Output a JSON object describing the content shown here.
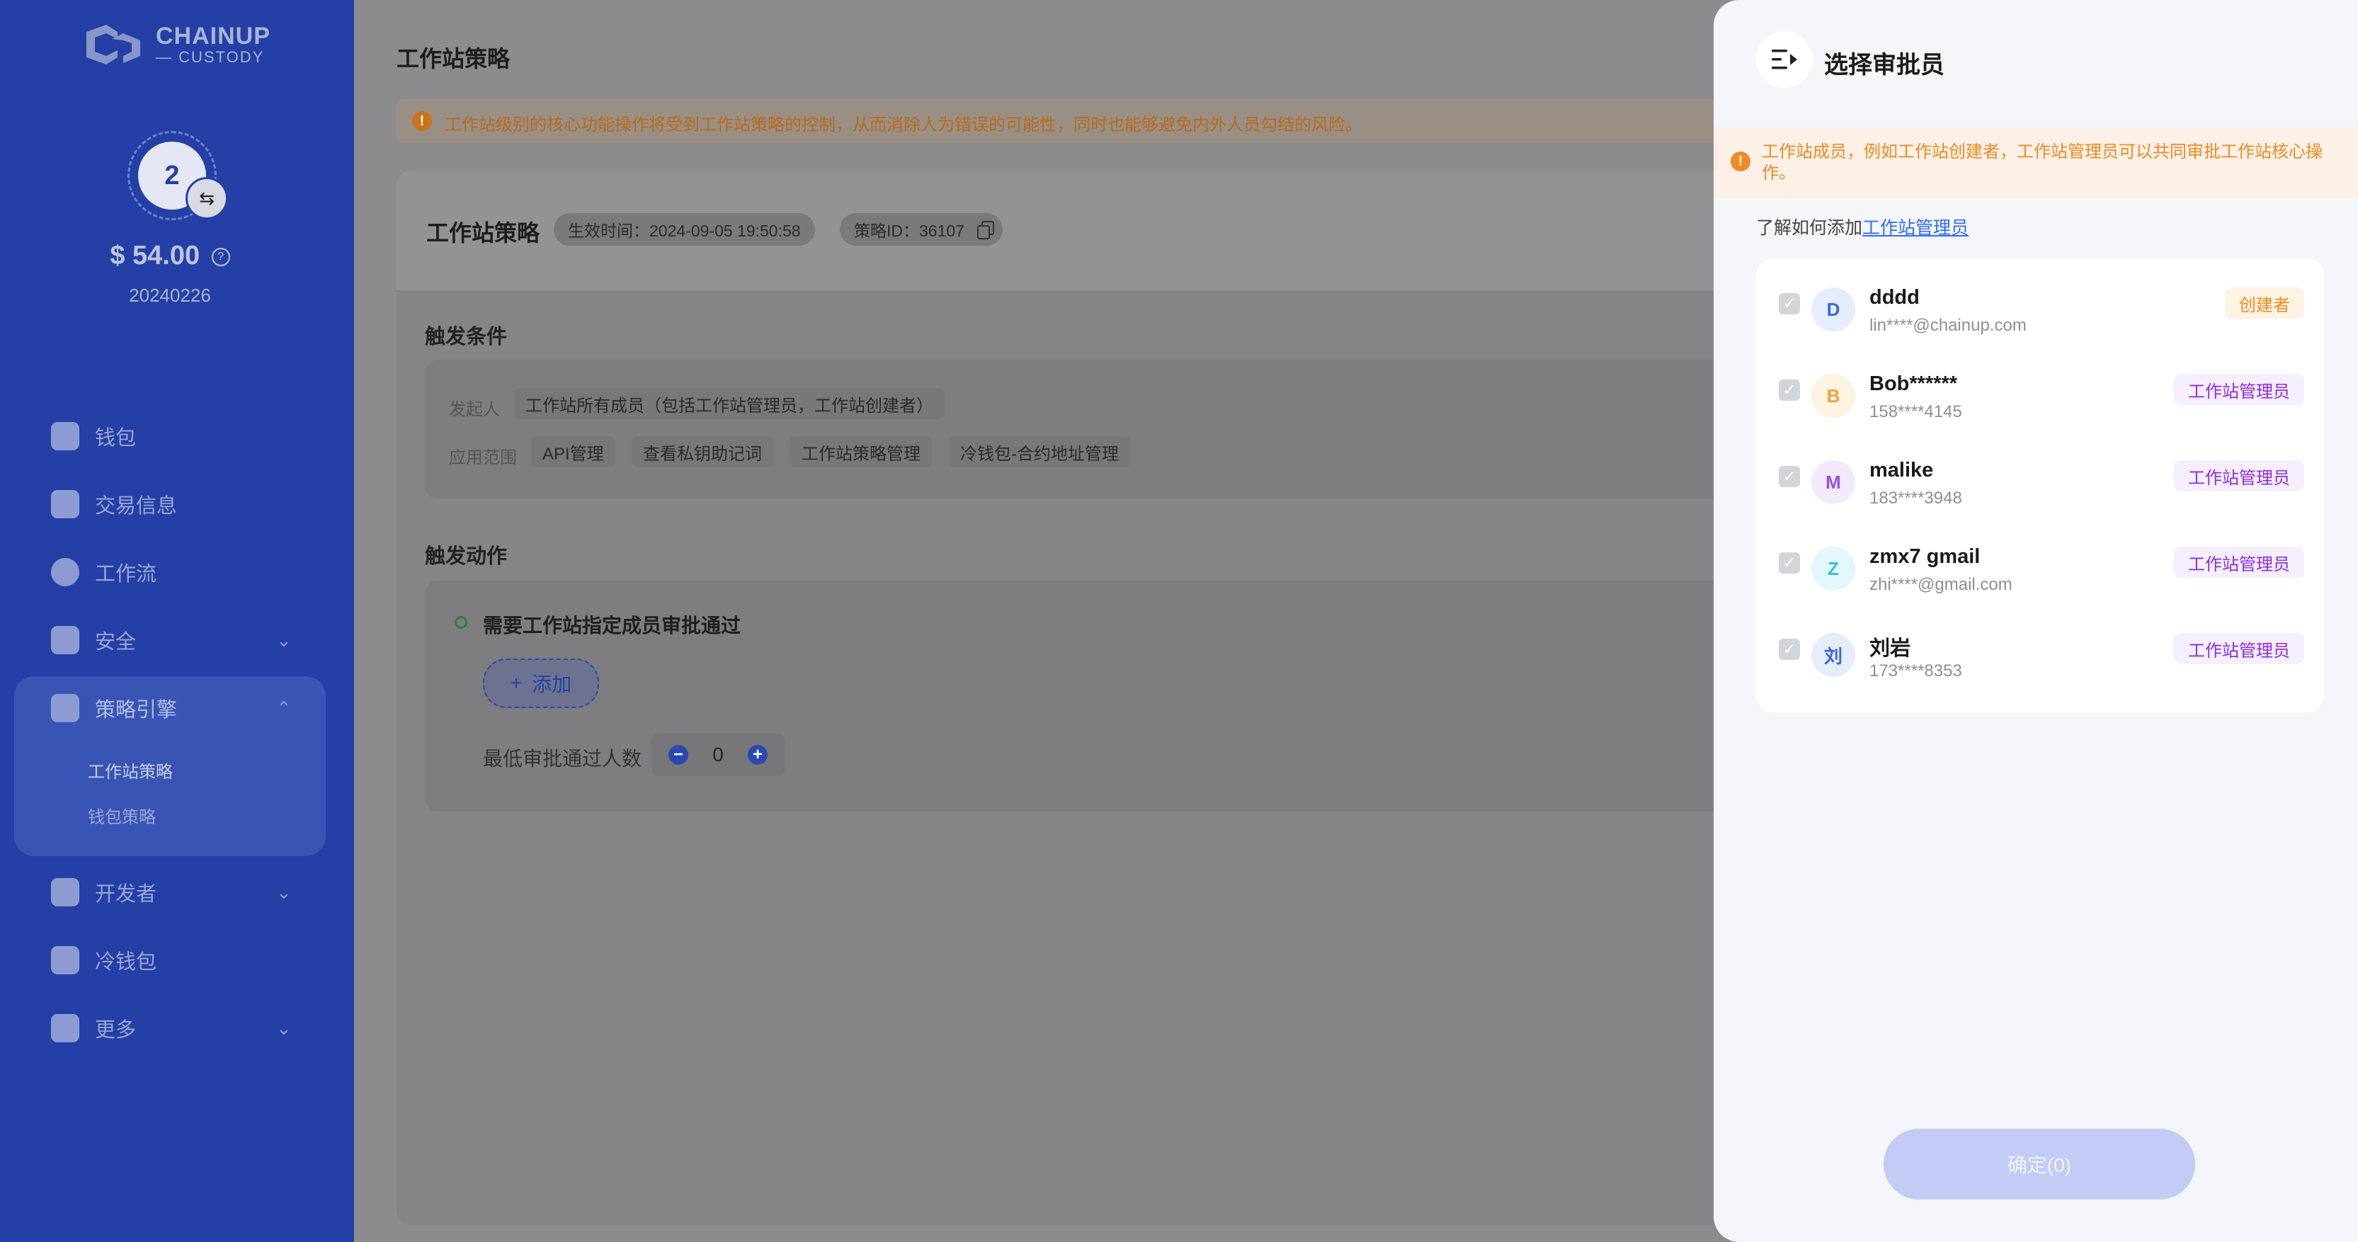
{
  "sidebar": {
    "logo": {
      "line1": "CHAINUP",
      "line2": "— CUSTODY"
    },
    "workspace": {
      "avatar_text": "2",
      "switch_icon": "⇆",
      "balance": "$ 54.00",
      "help_icon": "?",
      "name": "20240226"
    },
    "nav": [
      {
        "label": "钱包",
        "icon": "wallet-icon"
      },
      {
        "label": "交易信息",
        "icon": "transactions-icon"
      },
      {
        "label": "工作流",
        "icon": "workflow-icon"
      },
      {
        "label": "安全",
        "icon": "shield-icon",
        "chevron": "⌄"
      },
      {
        "label": "策略引擎",
        "icon": "policy-engine-icon",
        "chevron": "⌃"
      },
      {
        "label": "开发者",
        "icon": "developer-icon",
        "chevron": "⌄"
      },
      {
        "label": "冷钱包",
        "icon": "cold-wallet-icon"
      },
      {
        "label": "更多",
        "icon": "more-icon",
        "chevron": "⌄"
      }
    ],
    "sub_items": [
      "工作站策略",
      "钱包策略"
    ]
  },
  "main": {
    "page_title": "工作站策略",
    "warning": "工作站级别的核心功能操作将受到工作站策略的控制，从而消除人为错误的可能性，同时也能够避免内外人员勾结的风险。",
    "policy": {
      "title": "工作站策略",
      "effective": "生效时间：2024-09-05 19:50:58",
      "policy_id": "策略ID：36107"
    },
    "conditions": {
      "title": "触发条件",
      "initiator_label": "发起人",
      "initiator_value": "工作站所有成员（包括工作站管理员，工作站创建者）",
      "scope_label": "应用范围",
      "scope_tags": [
        "API管理",
        "查看私钥助记词",
        "工作站策略管理",
        "冷钱包-合约地址管理"
      ]
    },
    "actions": {
      "title": "触发动作",
      "requirement": "需要工作站指定成员审批通过",
      "add_label": "添加",
      "min_label": "最低审批通过人数",
      "min_value": "0"
    }
  },
  "drawer": {
    "title": "选择审批员",
    "warning": "工作站成员，例如工作站创建者，工作站管理员可以共同审批工作站核心操作。",
    "learn_prefix": "了解如何添加",
    "learn_link": "工作站管理员",
    "members": [
      {
        "initial": "D",
        "name": "dddd",
        "contact": "lin****@chainup.com",
        "role": "创建者",
        "role_type": "creator",
        "avatar_bg": "#e6edff",
        "avatar_color": "#3b63e8"
      },
      {
        "initial": "B",
        "name": "Bob******",
        "contact": "158****4145",
        "role": "工作站管理员",
        "role_type": "admin",
        "avatar_bg": "#fff3e2",
        "avatar_color": "#f5a23a"
      },
      {
        "initial": "M",
        "name": "malike",
        "contact": "183****3948",
        "role": "工作站管理员",
        "role_type": "admin",
        "avatar_bg": "#f3eaff",
        "avatar_color": "#9a4de8"
      },
      {
        "initial": "Z",
        "name": "zmx7 gmail",
        "contact": "zhi****@gmail.com",
        "role": "工作站管理员",
        "role_type": "admin",
        "avatar_bg": "#e3f7fc",
        "avatar_color": "#36bfe0"
      },
      {
        "initial": "刘",
        "name": "刘岩",
        "contact": "173****8353",
        "role": "工作站管理员",
        "role_type": "admin",
        "avatar_bg": "#e6edff",
        "avatar_color": "#3b63e8"
      }
    ],
    "confirm_label": "确定(0)"
  }
}
